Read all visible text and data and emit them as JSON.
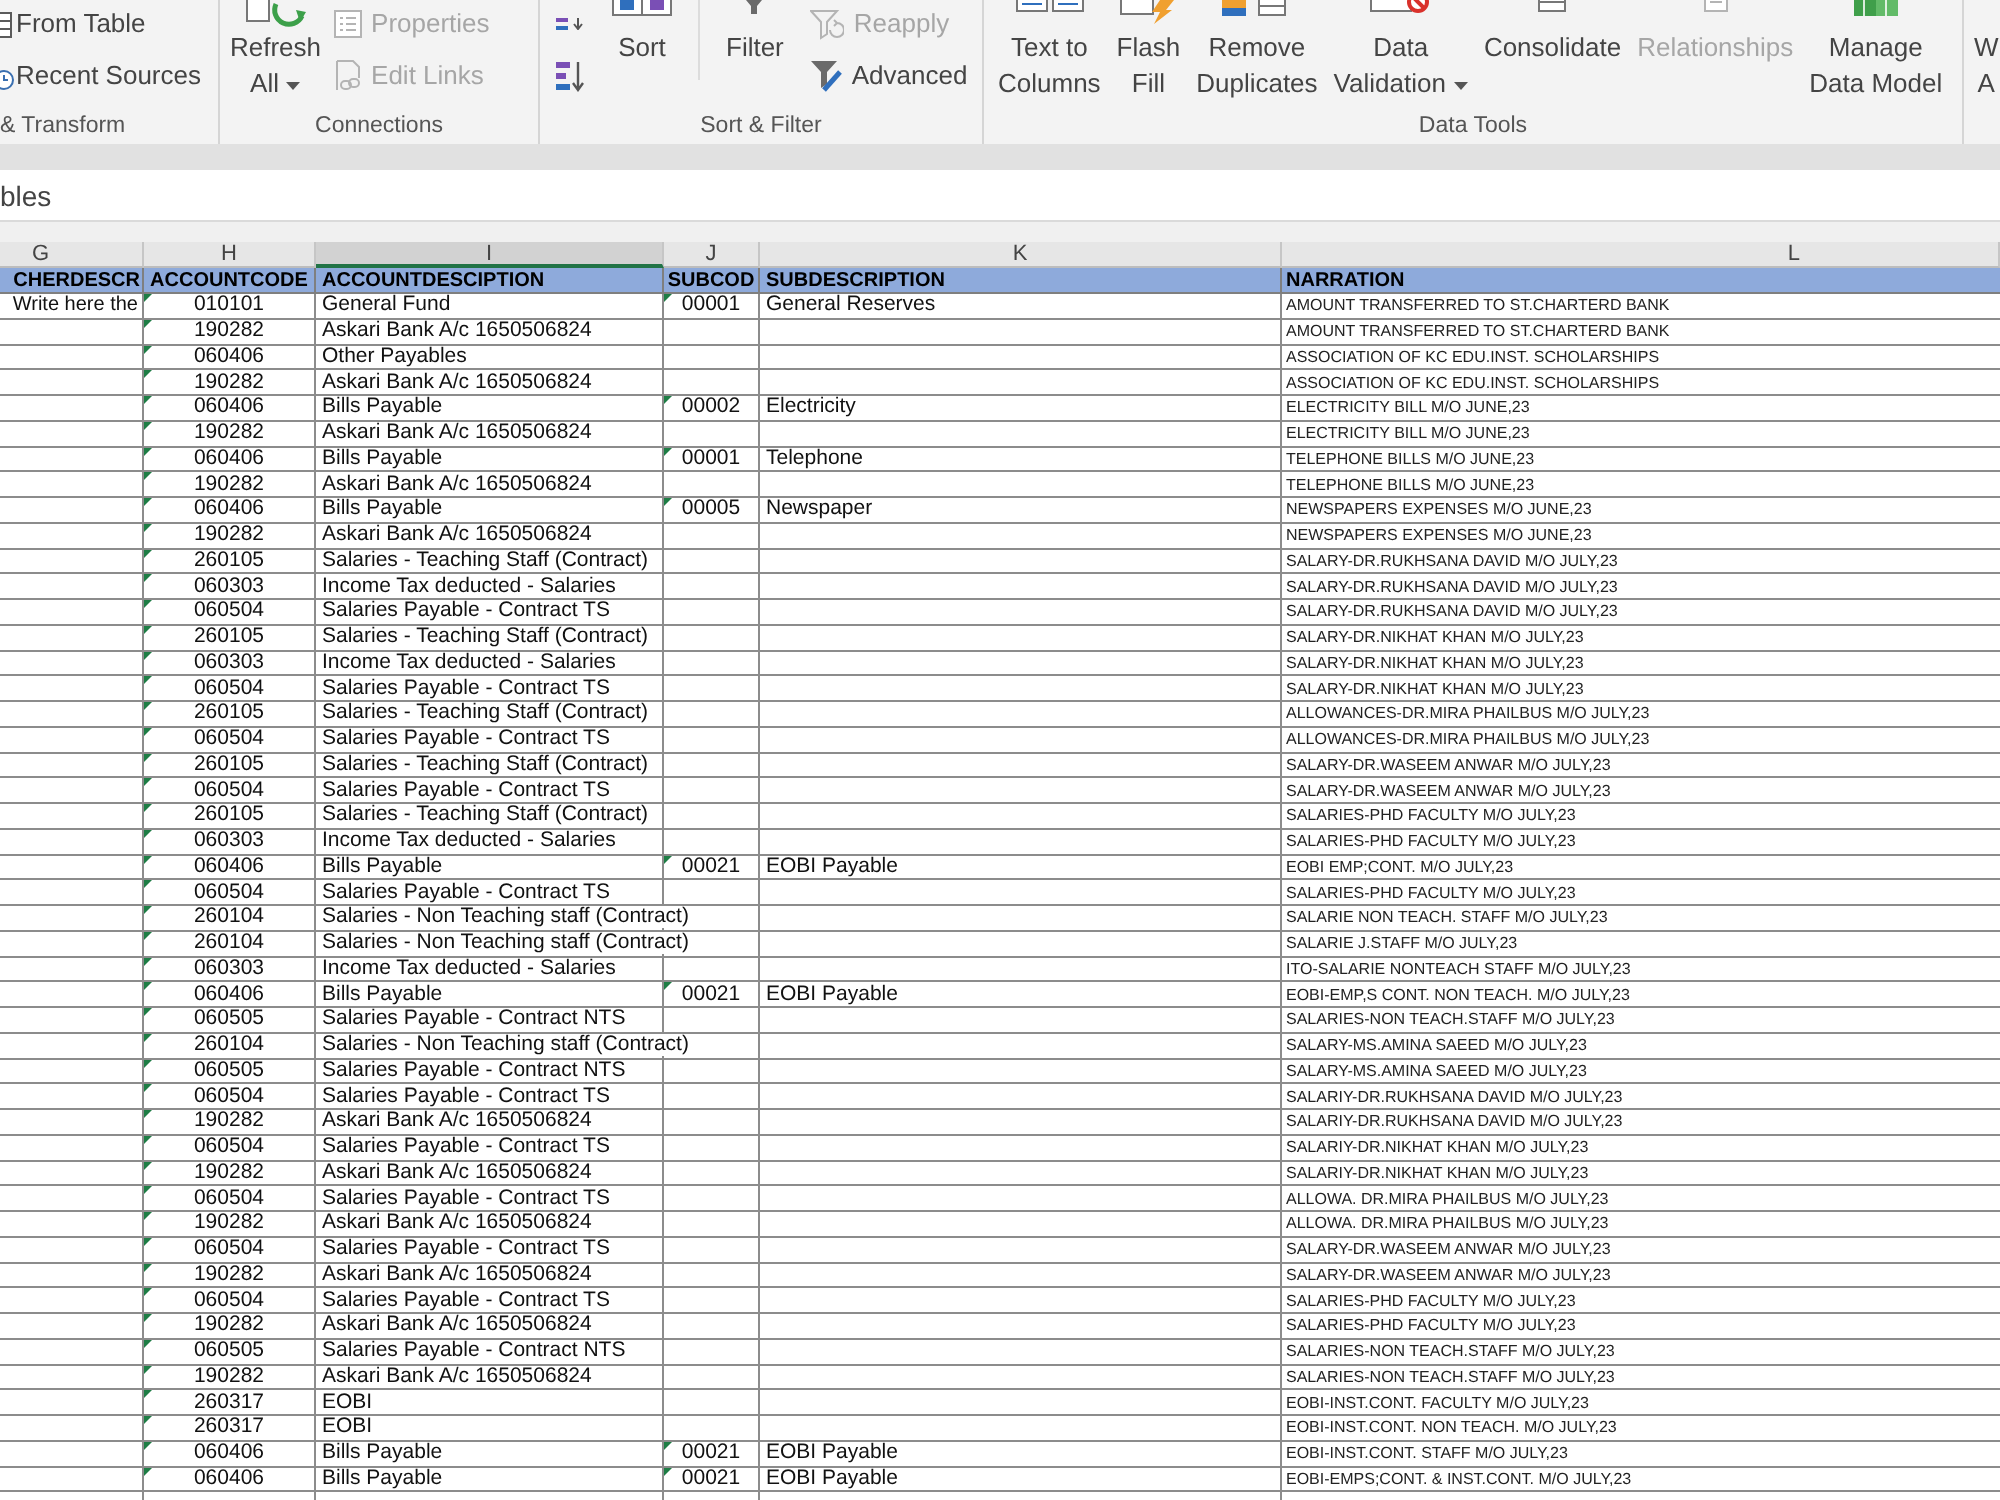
{
  "ribbon": {
    "groups": [
      {
        "label": "& Transform",
        "columns": [
          {
            "kind": "stack",
            "items": [
              {
                "label": "From Table",
                "disabled": false
              },
              {
                "label": "Recent Sources",
                "disabled": false
              }
            ]
          }
        ]
      },
      {
        "label": "Connections",
        "columns": [
          {
            "kind": "large",
            "lines": [
              "Refresh",
              "All"
            ],
            "dropdown": true,
            "disabled": false
          },
          {
            "kind": "stack",
            "items": [
              {
                "label": "Properties",
                "disabled": true
              },
              {
                "label": "Edit Links",
                "disabled": true
              }
            ]
          }
        ]
      },
      {
        "label": "Sort & Filter",
        "columns": [
          {
            "kind": "stack",
            "items": [
              {
                "disabled": false
              },
              {
                "disabled": false
              }
            ]
          },
          {
            "kind": "large",
            "lines": [
              "Sort"
            ],
            "dropdown": false,
            "disabled": false
          },
          {
            "kind": "large",
            "lines": [
              "Filter"
            ],
            "dropdown": false,
            "disabled": false
          },
          {
            "kind": "stack",
            "items": [
              {
                "label": "Reapply",
                "disabled": true
              },
              {
                "label": "Advanced",
                "disabled": false
              }
            ]
          }
        ]
      },
      {
        "label": "Data Tools",
        "columns": [
          {
            "kind": "large",
            "lines": [
              "Text to",
              "Columns"
            ],
            "dropdown": false,
            "disabled": false
          },
          {
            "kind": "large",
            "lines": [
              "Flash",
              "Fill"
            ],
            "dropdown": false,
            "disabled": false
          },
          {
            "kind": "large",
            "lines": [
              "Remove",
              "Duplicates"
            ],
            "dropdown": false,
            "disabled": false
          },
          {
            "kind": "large",
            "lines": [
              "Data",
              "Validation"
            ],
            "dropdown": true,
            "disabled": false
          },
          {
            "kind": "large",
            "lines": [
              "Consolidate"
            ],
            "dropdown": false,
            "disabled": false
          },
          {
            "kind": "large",
            "lines": [
              "Relationships"
            ],
            "dropdown": false,
            "disabled": true
          },
          {
            "kind": "large",
            "lines": [
              "Manage",
              "Data Model"
            ],
            "dropdown": false,
            "disabled": false
          }
        ]
      },
      {
        "columns": [
          {
            "kind": "large",
            "lines": [
              "W",
              "A"
            ],
            "dropdown": false,
            "disabled": false
          }
        ]
      }
    ]
  },
  "pane": {
    "title": "bles"
  },
  "sheet": {
    "columns": [
      {
        "letter": "G",
        "heading": "CHERDESCR",
        "selected": false,
        "flagged": false
      },
      {
        "letter": "H",
        "heading": "ACCOUNTCODE",
        "selected": false,
        "flagged": true
      },
      {
        "letter": "I",
        "heading": "ACCOUNTDESCIPTION",
        "selected": true,
        "flagged": false
      },
      {
        "letter": "J",
        "heading": "SUBCOD",
        "selected": false,
        "flagged": true
      },
      {
        "letter": "K",
        "heading": "SUBDESCRIPTION",
        "selected": false,
        "flagged": false
      },
      {
        "letter": "L",
        "heading": "NARRATION",
        "selected": false,
        "flagged": false
      }
    ],
    "rows": [
      {
        "column_g": "Write here the",
        "account_code": "010101",
        "account_description": "General Fund",
        "sub_code": "00001",
        "sub_description": "General Reserves",
        "narration": "AMOUNT TRANSFERRED TO ST.CHARTERD BANK"
      },
      {
        "account_code": "190282",
        "account_description": "Askari Bank A/c 1650506824",
        "narration": "AMOUNT TRANSFERRED TO ST.CHARTERD BANK"
      },
      {
        "account_code": "060406",
        "account_description": "Other Payables",
        "narration": "ASSOCIATION OF KC EDU.INST. SCHOLARSHIPS"
      },
      {
        "account_code": "190282",
        "account_description": "Askari Bank A/c 1650506824",
        "narration": "ASSOCIATION OF KC EDU.INST. SCHOLARSHIPS"
      },
      {
        "account_code": "060406",
        "account_description": "Bills Payable",
        "sub_code": "00002",
        "sub_description": "Electricity",
        "narration": "ELECTRICITY BILL M/O JUNE,23"
      },
      {
        "account_code": "190282",
        "account_description": "Askari Bank A/c 1650506824",
        "narration": "ELECTRICITY BILL M/O JUNE,23"
      },
      {
        "account_code": "060406",
        "account_description": "Bills Payable",
        "sub_code": "00001",
        "sub_description": "Telephone",
        "narration": "TELEPHONE BILLS M/O JUNE,23"
      },
      {
        "account_code": "190282",
        "account_description": "Askari Bank A/c 1650506824",
        "narration": "TELEPHONE BILLS M/O JUNE,23"
      },
      {
        "account_code": "060406",
        "account_description": "Bills Payable",
        "sub_code": "00005",
        "sub_description": "Newspaper",
        "narration": "NEWSPAPERS EXPENSES M/O JUNE,23"
      },
      {
        "account_code": "190282",
        "account_description": "Askari Bank A/c 1650506824",
        "narration": "NEWSPAPERS EXPENSES M/O JUNE,23"
      },
      {
        "account_code": "260105",
        "account_description": "Salaries - Teaching Staff (Contract)",
        "narration": "SALARY-DR.RUKHSANA DAVID M/O JULY,23"
      },
      {
        "account_code": "060303",
        "account_description": "Income Tax deducted - Salaries",
        "narration": "SALARY-DR.RUKHSANA DAVID M/O JULY,23"
      },
      {
        "account_code": "060504",
        "account_description": "Salaries Payable - Contract TS",
        "narration": "SALARY-DR.RUKHSANA DAVID M/O JULY,23"
      },
      {
        "account_code": "260105",
        "account_description": "Salaries - Teaching Staff (Contract)",
        "narration": "SALARY-DR.NIKHAT KHAN M/O JULY,23"
      },
      {
        "account_code": "060303",
        "account_description": "Income Tax deducted - Salaries",
        "narration": "SALARY-DR.NIKHAT KHAN M/O JULY,23"
      },
      {
        "account_code": "060504",
        "account_description": "Salaries Payable - Contract TS",
        "narration": "SALARY-DR.NIKHAT KHAN M/O JULY,23"
      },
      {
        "account_code": "260105",
        "account_description": "Salaries - Teaching Staff (Contract)",
        "narration": "ALLOWANCES-DR.MIRA PHAILBUS M/O JULY,23"
      },
      {
        "account_code": "060504",
        "account_description": "Salaries Payable - Contract TS",
        "narration": "ALLOWANCES-DR.MIRA PHAILBUS M/O JULY,23"
      },
      {
        "account_code": "260105",
        "account_description": "Salaries - Teaching Staff (Contract)",
        "narration": "SALARY-DR.WASEEM ANWAR M/O JULY,23"
      },
      {
        "account_code": "060504",
        "account_description": "Salaries Payable - Contract TS",
        "narration": "SALARY-DR.WASEEM ANWAR M/O JULY,23"
      },
      {
        "account_code": "260105",
        "account_description": "Salaries - Teaching Staff (Contract)",
        "narration": "SALARIES-PHD FACULTY M/O JULY,23"
      },
      {
        "account_code": "060303",
        "account_description": "Income Tax deducted - Salaries",
        "narration": "SALARIES-PHD FACULTY M/O JULY,23"
      },
      {
        "account_code": "060406",
        "account_description": "Bills Payable",
        "sub_code": "00021",
        "sub_description": "EOBI Payable",
        "narration": "EOBI EMP;CONT. M/O JULY,23"
      },
      {
        "account_code": "060504",
        "account_description": "Salaries Payable - Contract TS",
        "narration": "SALARIES-PHD FACULTY M/O JULY,23"
      },
      {
        "account_code": "260104",
        "account_description": "Salaries - Non Teaching staff (Contract)",
        "narration": "SALARIE NON TEACH. STAFF M/O JULY,23"
      },
      {
        "account_code": "260104",
        "account_description": "Salaries - Non Teaching staff (Contract)",
        "narration": "SALARIE J.STAFF M/O JULY,23"
      },
      {
        "account_code": "060303",
        "account_description": "Income Tax deducted - Salaries",
        "narration": "ITO-SALARIE NONTEACH STAFF M/O JULY,23"
      },
      {
        "account_code": "060406",
        "account_description": "Bills Payable",
        "sub_code": "00021",
        "sub_description": "EOBI Payable",
        "narration": "EOBI-EMP,S CONT. NON TEACH. M/O JULY,23"
      },
      {
        "account_code": "060505",
        "account_description": "Salaries Payable - Contract NTS",
        "narration": "SALARIES-NON TEACH.STAFF M/O JULY,23"
      },
      {
        "account_code": "260104",
        "account_description": "Salaries - Non Teaching staff (Contract)",
        "narration": "SALARY-MS.AMINA SAEED M/O JULY,23"
      },
      {
        "account_code": "060505",
        "account_description": "Salaries Payable - Contract NTS",
        "narration": "SALARY-MS.AMINA SAEED M/O JULY,23"
      },
      {
        "account_code": "060504",
        "account_description": "Salaries Payable - Contract TS",
        "narration": "SALARIY-DR.RUKHSANA DAVID M/O JULY,23"
      },
      {
        "account_code": "190282",
        "account_description": "Askari Bank A/c 1650506824",
        "narration": "SALARIY-DR.RUKHSANA DAVID M/O JULY,23"
      },
      {
        "account_code": "060504",
        "account_description": "Salaries Payable - Contract TS",
        "narration": "SALARIY-DR.NIKHAT KHAN M/O JULY,23"
      },
      {
        "account_code": "190282",
        "account_description": "Askari Bank A/c 1650506824",
        "narration": "SALARIY-DR.NIKHAT KHAN M/O JULY,23"
      },
      {
        "account_code": "060504",
        "account_description": "Salaries Payable - Contract TS",
        "narration": "ALLOWA. DR.MIRA PHAILBUS M/O JULY,23"
      },
      {
        "account_code": "190282",
        "account_description": "Askari Bank A/c 1650506824",
        "narration": "ALLOWA. DR.MIRA PHAILBUS M/O JULY,23"
      },
      {
        "account_code": "060504",
        "account_description": "Salaries Payable - Contract TS",
        "narration": "SALARY-DR.WASEEM ANWAR M/O JULY,23"
      },
      {
        "account_code": "190282",
        "account_description": "Askari Bank A/c 1650506824",
        "narration": "SALARY-DR.WASEEM ANWAR M/O JULY,23"
      },
      {
        "account_code": "060504",
        "account_description": "Salaries Payable - Contract TS",
        "narration": "SALARIES-PHD FACULTY M/O JULY,23"
      },
      {
        "account_code": "190282",
        "account_description": "Askari Bank A/c 1650506824",
        "narration": "SALARIES-PHD FACULTY M/O JULY,23"
      },
      {
        "account_code": "060505",
        "account_description": "Salaries Payable - Contract NTS",
        "narration": "SALARIES-NON TEACH.STAFF M/O JULY,23"
      },
      {
        "account_code": "190282",
        "account_description": "Askari Bank A/c 1650506824",
        "narration": "SALARIES-NON TEACH.STAFF M/O JULY,23"
      },
      {
        "account_code": "260317",
        "account_description": "EOBI",
        "narration": "EOBI-INST.CONT. FACULTY M/O JULY,23"
      },
      {
        "account_code": "260317",
        "account_description": "EOBI",
        "narration": "EOBI-INST.CONT. NON TEACH. M/O JULY,23"
      },
      {
        "account_code": "060406",
        "account_description": "Bills Payable",
        "sub_code": "00021",
        "sub_description": "EOBI Payable",
        "narration": "EOBI-INST.CONT. STAFF M/O JULY,23"
      },
      {
        "account_code": "060406",
        "account_description": "Bills Payable",
        "sub_code": "00021",
        "sub_description": "EOBI Payable",
        "narration": "EOBI-EMPS;CONT. & INST.CONT. M/O JULY,23"
      }
    ]
  }
}
